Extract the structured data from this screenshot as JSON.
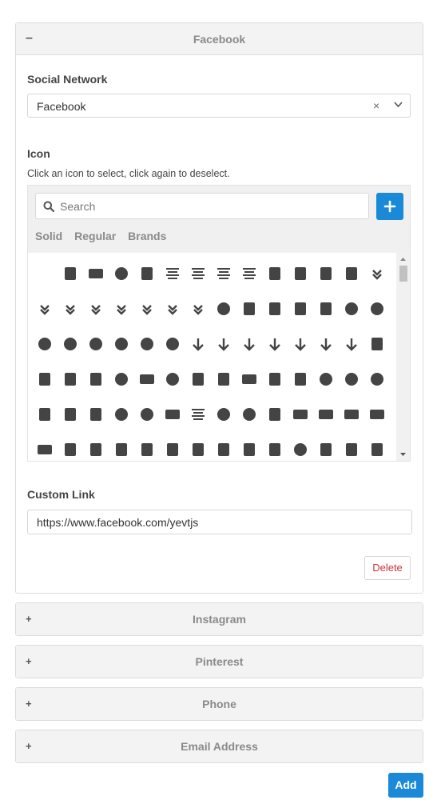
{
  "panels": {
    "facebook": {
      "toggle": "–",
      "title": "Facebook"
    },
    "instagram": {
      "toggle": "+",
      "title": "Instagram"
    },
    "pinterest": {
      "toggle": "+",
      "title": "Pinterest"
    },
    "phone": {
      "toggle": "+",
      "title": "Phone"
    },
    "email": {
      "toggle": "+",
      "title": "Email Address"
    }
  },
  "social_network": {
    "label": "Social Network",
    "value": "Facebook",
    "clear": "×"
  },
  "icon_field": {
    "label": "Icon",
    "help": "Click an icon to select, click again to deselect.",
    "search_placeholder": "Search",
    "tabs": [
      "Solid",
      "Regular",
      "Brands"
    ],
    "add_button": "+",
    "icons": [
      [
        "",
        "address-book",
        "address-card",
        "adjust",
        "air-freshener",
        "align-center",
        "align-justify",
        "align-left",
        "align-right",
        "allergies",
        "ambulance",
        "american-sign-language",
        "anchor",
        "angle-double-down"
      ],
      [
        "angle-double-left",
        "angle-double-right",
        "angle-double-up",
        "angle-down",
        "angle-left",
        "angle-right",
        "angle-up",
        "angry",
        "ankh",
        "apple-alt",
        "archive",
        "archway",
        "arrow-alt-circle-down",
        "arrow-alt-circle-left"
      ],
      [
        "arrow-alt-circle-right",
        "arrow-alt-circle-up",
        "arrow-circle-down",
        "arrow-circle-left",
        "arrow-circle-right",
        "arrow-circle-up",
        "arrow-down",
        "arrow-left",
        "arrow-right",
        "arrow-up",
        "arrows-alt",
        "arrows-alt-h",
        "arrows-alt-v",
        "assistive-listening"
      ],
      [
        "asterisk",
        "at",
        "atlas",
        "atom",
        "audio-description",
        "award",
        "baby",
        "baby-carriage",
        "backspace",
        "backward",
        "bacon",
        "bacteria",
        "bacterium",
        "bahai"
      ],
      [
        "balance-scale",
        "balance-scale-left",
        "balance-scale-right",
        "ban",
        "band-aid",
        "barcode",
        "bars",
        "baseball-ball",
        "basketball-ball",
        "bath",
        "battery-empty",
        "battery-full",
        "battery-half",
        "battery-quarter"
      ],
      [
        "battery-three-quarters",
        "bed",
        "beer",
        "bell",
        "bell-slash",
        "bezier-curve",
        "bible",
        "bicycle",
        "biking",
        "binoculars",
        "biohazard",
        "birthday-cake",
        "blender",
        "blender-phone"
      ]
    ]
  },
  "custom_link": {
    "label": "Custom Link",
    "value": "https://www.facebook.com/yevtjs"
  },
  "buttons": {
    "delete": "Delete",
    "add": "Add"
  },
  "colors": {
    "accent": "#1a8ad8",
    "danger": "#d0323a",
    "icon": "#444444"
  }
}
